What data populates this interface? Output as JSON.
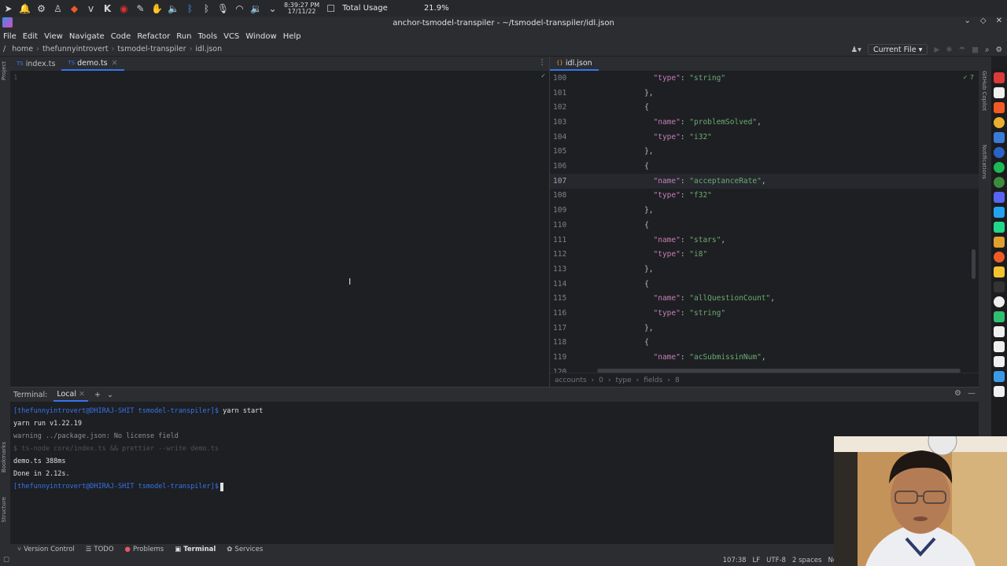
{
  "system_bar": {
    "clock_time": "8:39:27 PM",
    "clock_date": "17/11/22",
    "usage_label": "Total Usage",
    "usage_value": "21.9%"
  },
  "window": {
    "title": "anchor-tsmodel-transpiler - ~/tsmodel-transpiler/idl.json"
  },
  "menu": [
    "File",
    "Edit",
    "View",
    "Navigate",
    "Code",
    "Refactor",
    "Run",
    "Tools",
    "VCS",
    "Window",
    "Help"
  ],
  "breadcrumb": {
    "items": [
      "/",
      "home",
      "thefunnyintrovert",
      "tsmodel-transpiler",
      "idl.json"
    ],
    "run_config": "Current File"
  },
  "left_strip": {
    "project": "Project",
    "bookmarks": "Bookmarks",
    "structure": "Structure"
  },
  "right_strip": {
    "copilot": "GitHub Copilot",
    "notifications": "Notifications"
  },
  "left_editor": {
    "tabs": [
      "index.ts",
      "demo.ts"
    ],
    "active_tab": "demo.ts",
    "line_numbers": [
      "1"
    ]
  },
  "right_editor": {
    "tab": "idl.json",
    "inspection": "✓ 7",
    "lines": [
      {
        "n": "100",
        "indent": "      ",
        "key": "\"type\"",
        "val": "\"string\"",
        "tail": ""
      },
      {
        "n": "101",
        "indent": "    ",
        "raw": "},"
      },
      {
        "n": "102",
        "indent": "    ",
        "raw": "{"
      },
      {
        "n": "103",
        "indent": "      ",
        "key": "\"name\"",
        "val": "\"problemSolved\"",
        "tail": ","
      },
      {
        "n": "104",
        "indent": "      ",
        "key": "\"type\"",
        "val": "\"i32\"",
        "tail": ""
      },
      {
        "n": "105",
        "indent": "    ",
        "raw": "},"
      },
      {
        "n": "106",
        "indent": "    ",
        "raw": "{"
      },
      {
        "n": "107",
        "indent": "      ",
        "key": "\"name\"",
        "val": "\"acceptanceRate\"",
        "tail": ","
      },
      {
        "n": "108",
        "indent": "      ",
        "key": "\"type\"",
        "val": "\"f32\"",
        "tail": ""
      },
      {
        "n": "109",
        "indent": "    ",
        "raw": "},"
      },
      {
        "n": "110",
        "indent": "    ",
        "raw": "{"
      },
      {
        "n": "111",
        "indent": "      ",
        "key": "\"name\"",
        "val": "\"stars\"",
        "tail": ","
      },
      {
        "n": "112",
        "indent": "      ",
        "key": "\"type\"",
        "val": "\"i8\"",
        "tail": ""
      },
      {
        "n": "113",
        "indent": "    ",
        "raw": "},"
      },
      {
        "n": "114",
        "indent": "    ",
        "raw": "{"
      },
      {
        "n": "115",
        "indent": "      ",
        "key": "\"name\"",
        "val": "\"allQuestionCount\"",
        "tail": ","
      },
      {
        "n": "116",
        "indent": "      ",
        "key": "\"type\"",
        "val": "\"string\"",
        "tail": ""
      },
      {
        "n": "117",
        "indent": "    ",
        "raw": "},"
      },
      {
        "n": "118",
        "indent": "    ",
        "raw": "{"
      },
      {
        "n": "119",
        "indent": "      ",
        "key": "\"name\"",
        "val": "\"acSubmissinNum\"",
        "tail": ","
      },
      {
        "n": "120",
        "indent": "",
        "raw": ""
      }
    ],
    "current_line": "107",
    "status_path": [
      "accounts",
      "0",
      "type",
      "fields",
      "8"
    ]
  },
  "terminal": {
    "label": "Terminal:",
    "tab": "Local",
    "lines": [
      {
        "prompt": "[thefunnyintrovert@DHIRAJ-SHIT tsmodel-transpiler]$",
        "cmd": " yarn start",
        "style": "prompt"
      },
      {
        "text": "yarn run v1.22.19",
        "style": "normal"
      },
      {
        "text": "warning ../package.json: No license field",
        "style": "warn"
      },
      {
        "text": "$ ts-node core/index.ts && prettier --write demo.ts",
        "style": "dim"
      },
      {
        "text": "demo.ts 388ms",
        "style": "normal"
      },
      {
        "text": "Done in 2.12s.",
        "style": "normal"
      },
      {
        "prompt": "[thefunnyintrovert@DHIRAJ-SHIT tsmodel-transpiler]$",
        "cmd": "",
        "style": "prompt-cursor"
      }
    ]
  },
  "bottom_tools": [
    "Version Control",
    "TODO",
    "Problems",
    "Terminal",
    "Services"
  ],
  "active_bottom_tool": "Terminal",
  "status_bar": {
    "position": "107:38",
    "line_ending": "LF",
    "encoding": "UTF-8",
    "indent": "2 spaces",
    "schema": "No"
  },
  "colors": {
    "accent": "#3574f0",
    "string": "#6aab73",
    "key": "#c77dbb"
  }
}
